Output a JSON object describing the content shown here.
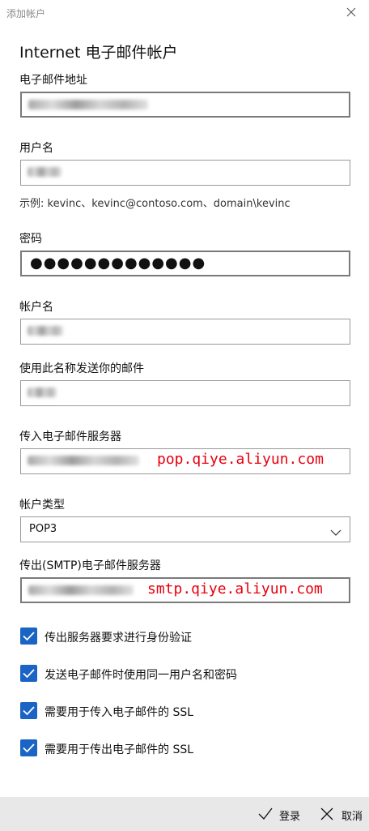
{
  "window": {
    "title": "添加帐户"
  },
  "heading": "Internet 电子邮件帐户",
  "fields": {
    "email": {
      "label": "电子邮件地址"
    },
    "username": {
      "label": "用户名",
      "hint": "示例: kevinc、kevinc@contoso.com、domain\\kevinc"
    },
    "password": {
      "label": "密码",
      "value": "●●●●●●●●●●●●●"
    },
    "account_name": {
      "label": "帐户名"
    },
    "send_name": {
      "label": "使用此名称发送你的邮件"
    },
    "incoming": {
      "label": "传入电子邮件服务器",
      "overlay": "pop.qiye.aliyun.com"
    },
    "account_type": {
      "label": "帐户类型",
      "value": "POP3"
    },
    "outgoing": {
      "label": "传出(SMTP)电子邮件服务器",
      "overlay": "smtp.qiye.aliyun.com"
    }
  },
  "checkboxes": [
    {
      "label": "传出服务器要求进行身份验证",
      "checked": true
    },
    {
      "label": "发送电子邮件时使用同一用户名和密码",
      "checked": true
    },
    {
      "label": "需要用于传入电子邮件的 SSL",
      "checked": true
    },
    {
      "label": "需要用于传出电子邮件的 SSL",
      "checked": true
    }
  ],
  "footer": {
    "signin_label": "登录",
    "cancel_label": "取消"
  },
  "colors": {
    "accent": "#1a64c6",
    "overlay_red": "#e8000e",
    "footer_bg": "#e8e8e8"
  },
  "icons": {
    "close": "close-icon",
    "chevron": "chevron-down-icon",
    "check": "checkmark-icon",
    "signin": "checkmark-icon",
    "cancel": "close-icon"
  }
}
